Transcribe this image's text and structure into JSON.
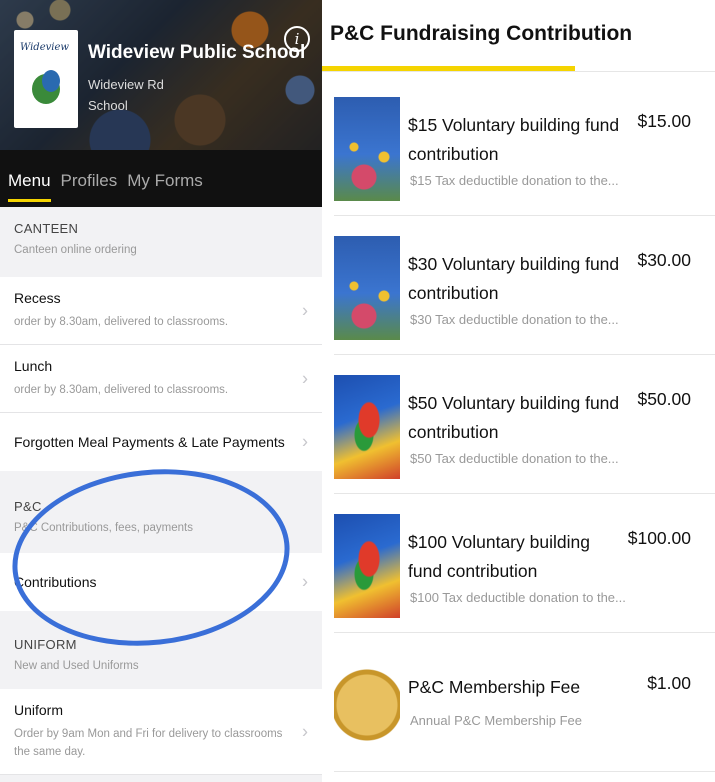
{
  "left": {
    "school_name": "Wideview Public School",
    "address_line1": "Wideview Rd",
    "address_line2": "School",
    "logo_text": "Wideview",
    "tabs": [
      "Menu",
      "Profiles",
      "My Forms"
    ],
    "sections": [
      {
        "title": "CANTEEN",
        "subtitle": "Canteen online ordering"
      },
      {
        "title": "P&C",
        "subtitle": "P&C Contributions, fees, payments"
      },
      {
        "title": "UNIFORM",
        "subtitle": "New and Used Uniforms"
      }
    ],
    "rows": {
      "recess": {
        "title": "Recess",
        "subtitle": "order by 8.30am, delivered to classrooms."
      },
      "lunch": {
        "title": "Lunch",
        "subtitle": "order by 8.30am, delivered to classrooms."
      },
      "forgotten": {
        "title": "Forgotten Meal Payments & Late Payments"
      },
      "contributions": {
        "title": "Contributions"
      },
      "uniform": {
        "title": "Uniform",
        "subtitle": "Order by 9am Mon and Fri for delivery to classrooms the same day."
      }
    },
    "chevron": "›",
    "info_icon": "i"
  },
  "right": {
    "title": "P&C Fundraising Contribution",
    "accent_color": "#f5d400",
    "products": [
      {
        "name": "$15 Voluntary building fund contribution",
        "price": "$15.00",
        "desc": "$15 Tax deductible donation to the...",
        "thumb": "mural-wall"
      },
      {
        "name": "$30 Voluntary building fund contribution",
        "price": "$30.00",
        "desc": "$30 Tax deductible donation to the...",
        "thumb": "mural-wall"
      },
      {
        "name": "$50 Voluntary building fund contribution",
        "price": "$50.00",
        "desc": "$50 Tax deductible donation to the...",
        "thumb": "mural-bird"
      },
      {
        "name": "$100 Voluntary building fund contribution",
        "price": "$100.00",
        "desc": "$100 Tax deductible donation to the...",
        "thumb": "mural-bird"
      },
      {
        "name": "P&C Membership Fee",
        "price": "$1.00",
        "desc": "Annual P&C Membership Fee",
        "thumb": "dollar-coin"
      }
    ]
  }
}
